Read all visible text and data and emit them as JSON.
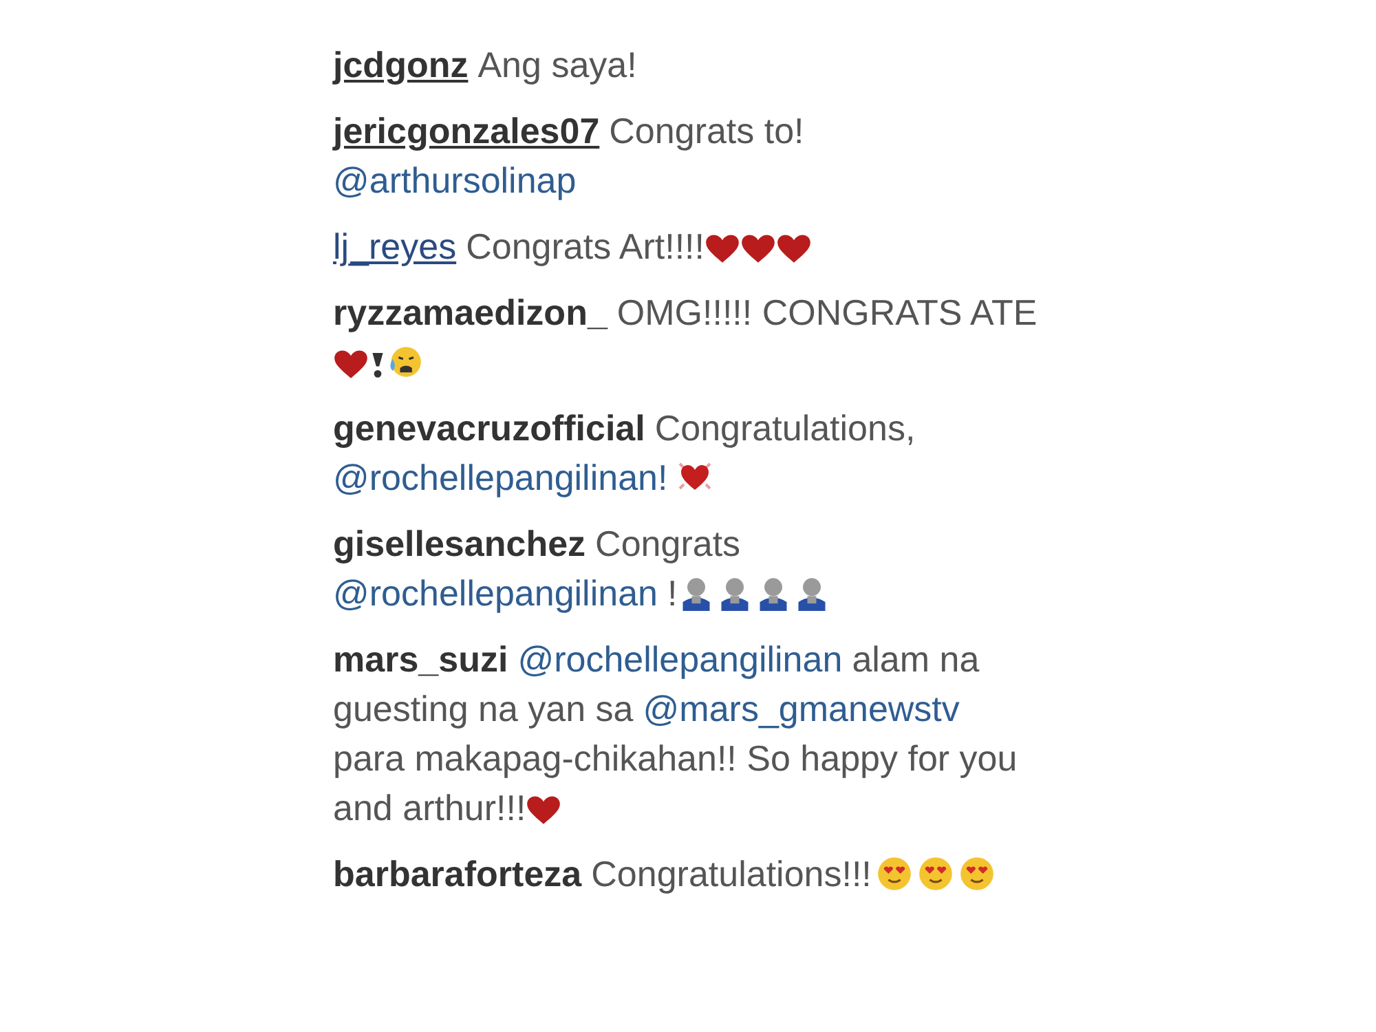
{
  "comments": [
    {
      "username": "jcdgonz",
      "underlined": true,
      "hovered": false,
      "lines": [
        [
          {
            "kind": "text",
            "text": "Ang saya!"
          }
        ]
      ]
    },
    {
      "username": "jericgonzales07",
      "underlined": true,
      "hovered": false,
      "lines": [
        [
          {
            "kind": "text",
            "text": "Congrats to!"
          }
        ],
        [
          {
            "kind": "mention",
            "text": "@arthursolinap"
          }
        ]
      ]
    },
    {
      "username": "lj_reyes",
      "underlined": true,
      "hovered": true,
      "lines": [
        [
          {
            "kind": "text",
            "text": "Congrats Art!!!!"
          },
          {
            "kind": "heart"
          },
          {
            "kind": "heart"
          },
          {
            "kind": "heart"
          }
        ]
      ]
    },
    {
      "username": "ryzzamaedizon_",
      "underlined": false,
      "hovered": false,
      "lines": [
        [
          {
            "kind": "text",
            "text": "OMG!!!!! CONGRATS ATE"
          }
        ],
        [
          {
            "kind": "heart"
          },
          {
            "kind": "exclamation"
          },
          {
            "kind": "crying"
          }
        ]
      ]
    },
    {
      "username": "genevacruzofficial",
      "underlined": false,
      "hovered": false,
      "lines": [
        [
          {
            "kind": "text",
            "text": "Congratulations,"
          }
        ],
        [
          {
            "kind": "mention",
            "text": "@rochellepangilinan!"
          },
          {
            "kind": "glowheart"
          }
        ]
      ]
    },
    {
      "username": "gisellesanchez",
      "underlined": false,
      "hovered": false,
      "lines": [
        [
          {
            "kind": "text",
            "text": "Congrats"
          }
        ],
        [
          {
            "kind": "mention",
            "text": "@rochellepangilinan"
          },
          {
            "kind": "text",
            "text": "!"
          },
          {
            "kind": "figure"
          },
          {
            "kind": "figure"
          },
          {
            "kind": "figure"
          },
          {
            "kind": "figure"
          }
        ]
      ]
    },
    {
      "username": "mars_suzi",
      "underlined": false,
      "hovered": false,
      "lines": [
        [
          {
            "kind": "mention",
            "text": "@rochellepangilinan"
          },
          {
            "kind": "text",
            "text": "alam na"
          }
        ],
        [
          {
            "kind": "text",
            "text": "guesting na yan sa"
          },
          {
            "kind": "mention",
            "text": "@mars_gmanewstv"
          }
        ],
        [
          {
            "kind": "text",
            "text": "para makapag-chikahan!! So happy for you"
          }
        ],
        [
          {
            "kind": "text",
            "text": "and arthur!!!"
          },
          {
            "kind": "heart"
          }
        ]
      ]
    },
    {
      "username": "barbaraforteza",
      "underlined": false,
      "hovered": false,
      "lines": [
        [
          {
            "kind": "text",
            "text": "Congratulations!!!"
          },
          {
            "kind": "hearteyes"
          },
          {
            "kind": "hearteyes"
          },
          {
            "kind": "hearteyes"
          }
        ]
      ]
    }
  ]
}
